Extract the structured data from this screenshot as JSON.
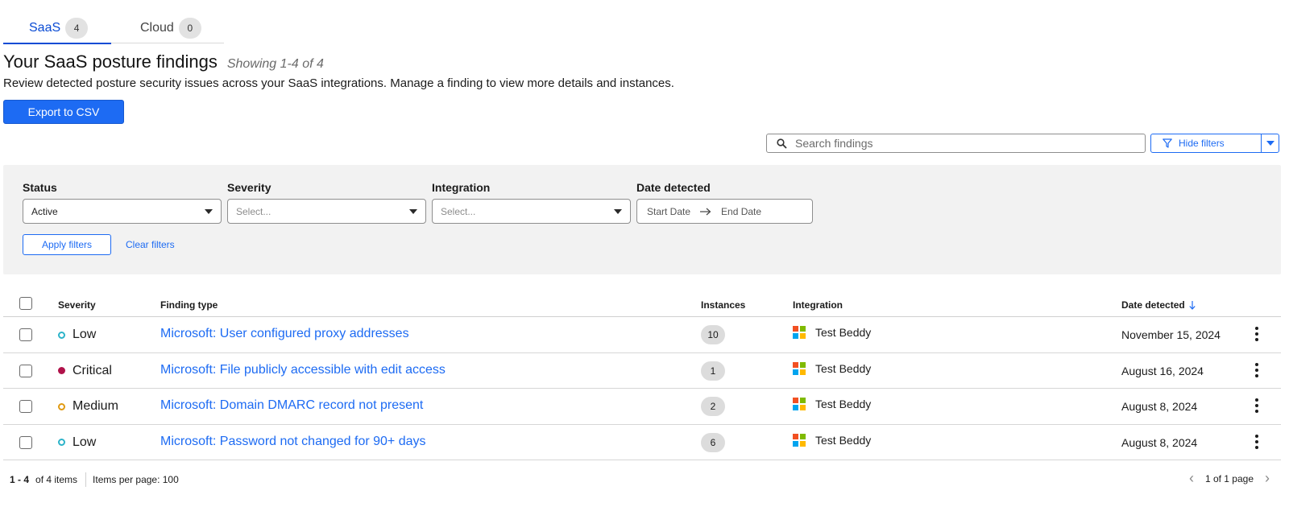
{
  "tabs": [
    {
      "label": "SaaS",
      "count": "4"
    },
    {
      "label": "Cloud",
      "count": "0"
    }
  ],
  "header": {
    "title": "Your SaaS posture findings",
    "showing": "Showing 1-4 of 4",
    "description": "Review detected posture security issues across your SaaS integrations. Manage a finding to view more details and instances.",
    "export_label": "Export to CSV"
  },
  "search": {
    "placeholder": "Search findings"
  },
  "filter_toggle": {
    "label": "Hide filters"
  },
  "filters": {
    "status": {
      "label": "Status",
      "value": "Active"
    },
    "severity": {
      "label": "Severity",
      "value": "Select..."
    },
    "integration": {
      "label": "Integration",
      "value": "Select..."
    },
    "date": {
      "label": "Date detected",
      "start": "Start Date",
      "end": "End Date"
    },
    "apply_label": "Apply filters",
    "clear_label": "Clear filters"
  },
  "table": {
    "columns": {
      "severity": "Severity",
      "finding_type": "Finding type",
      "instances": "Instances",
      "integration": "Integration",
      "date_detected": "Date detected"
    },
    "rows": [
      {
        "severity": "Low",
        "finding": "Microsoft: User configured proxy addresses",
        "instances": "10",
        "integration": "Test Beddy",
        "date": "November 15, 2024"
      },
      {
        "severity": "Critical",
        "finding": "Microsoft: File publicly accessible with edit access",
        "instances": "1",
        "integration": "Test Beddy",
        "date": "August 16, 2024"
      },
      {
        "severity": "Medium",
        "finding": "Microsoft: Domain DMARC record not present",
        "instances": "2",
        "integration": "Test Beddy",
        "date": "August 8, 2024"
      },
      {
        "severity": "Low",
        "finding": "Microsoft: Password not changed for 90+ days",
        "instances": "6",
        "integration": "Test Beddy",
        "date": "August 8, 2024"
      }
    ]
  },
  "pagination": {
    "range": "1 - 4",
    "of_items": "of 4 items",
    "per_page": "Items per page: 100",
    "page_info": "1 of 1 page"
  },
  "colors": {
    "accent": "#1d6bf3",
    "severity_low": "#2cb3c9",
    "severity_critical": "#b0124a",
    "severity_medium": "#e09a12",
    "ms_red": "#f25022",
    "ms_green": "#7fba00",
    "ms_blue": "#00a4ef",
    "ms_yellow": "#ffb900"
  },
  "icons": {
    "search": "search-icon",
    "filter": "filter-icon",
    "sort": "arrow-down-icon",
    "more": "kebab-icon",
    "integration": "microsoft-logo-icon"
  }
}
